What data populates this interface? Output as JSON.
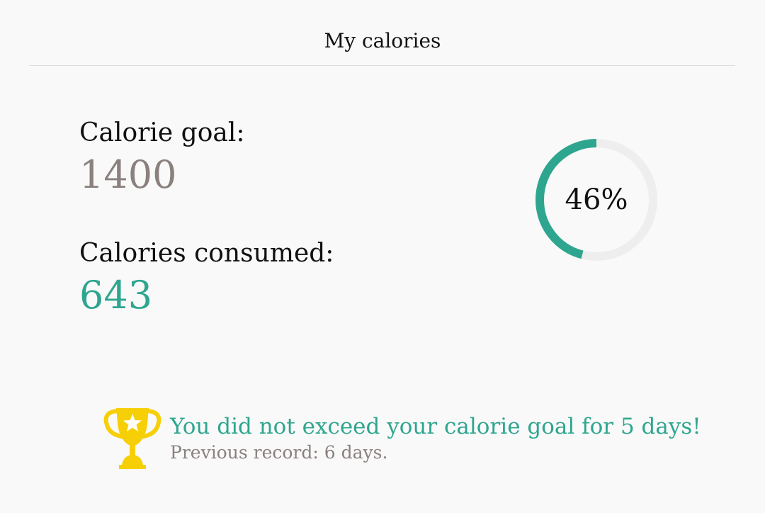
{
  "header": {
    "title": "My calories"
  },
  "stats": {
    "goal_label": "Calorie goal:",
    "goal_value": "1400",
    "consumed_label": "Calories consumed:",
    "consumed_value": "643"
  },
  "progress": {
    "percent_text": "46%",
    "fraction": 0.46,
    "track_color": "#eeeeee",
    "fill_color": "#2ea68f"
  },
  "achievement": {
    "icon": "trophy-icon",
    "message": "You did not exceed your calorie goal for 5 days!",
    "record": "Previous record: 6 days."
  },
  "colors": {
    "accent": "#2ea68f",
    "muted": "#8a807e",
    "text": "#111111",
    "trophy": "#f7cf06"
  }
}
